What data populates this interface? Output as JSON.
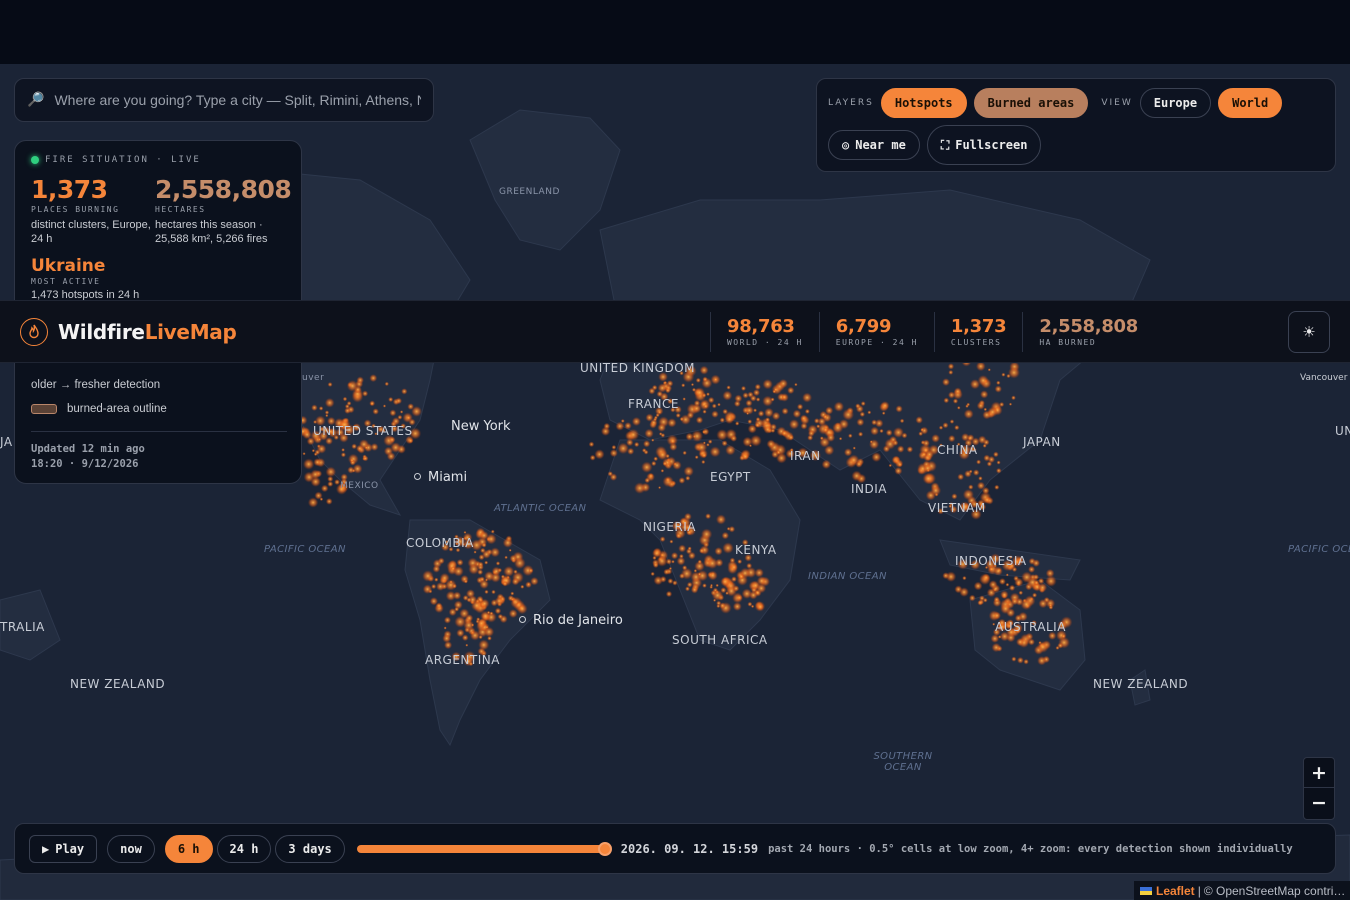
{
  "search": {
    "placeholder": "Where are you going? Type a city — Split, Rimini, Athens, Nice…"
  },
  "layers": {
    "layers_label": "LAYERS",
    "hotspots": "Hotspots",
    "burned_areas": "Burned areas",
    "view_label": "VIEW",
    "europe": "Europe",
    "world": "World",
    "near_me": "Near me",
    "fullscreen": "Fullscreen"
  },
  "situation": {
    "title": "FIRE SITUATION · LIVE",
    "places_value": "1,373",
    "places_label": "PLACES BURNING",
    "places_desc": "distinct clusters, Europe, 24 h",
    "hectares_value": "2,558,808",
    "hectares_label": "HECTARES",
    "hectares_desc": "hectares this season · 25,588 km², 5,266 fires",
    "most_active_value": "Ukraine",
    "most_active_label": "MOST ACTIVE",
    "most_active_desc": "1,473 hotspots in 24 h",
    "legend_fresh": "older → fresher detection",
    "legend_burned": "burned-area outline",
    "updated_line1": "Updated 12 min ago",
    "updated_line2": "18:20 · 9/12/2026"
  },
  "header": {
    "brand_first": "Wildfire",
    "brand_second": "LiveMap",
    "stats": [
      {
        "value": "98,763",
        "label": "WORLD · 24 H"
      },
      {
        "value": "6,799",
        "label": "EUROPE · 24 H"
      },
      {
        "value": "1,373",
        "label": "CLUSTERS"
      },
      {
        "value": "2,558,808",
        "label": "HA BURNED"
      }
    ],
    "theme_icon": "☀"
  },
  "map": {
    "labels": {
      "greenland": "GREENLAND",
      "uk": "UNITED KINGDOM",
      "france": "FRANCE",
      "us": "UNITED STATES",
      "mexico": "MEXICO",
      "iran": "IRAN",
      "china": "CHINA",
      "japan": "JAPAN",
      "egypt": "EGYPT",
      "india": "INDIA",
      "vietnam": "VIETNAM",
      "nigeria": "NIGERIA",
      "kenya": "KENYA",
      "colombia": "COLOMBIA",
      "indonesia": "INDONESIA",
      "australia": "AUSTRALIA",
      "australia_left": "TRALIA",
      "south_africa": "SOUTH AFRICA",
      "argentina": "ARGENTINA",
      "nz_left": "NEW ZEALAND",
      "nz_right": "NEW ZEALAND",
      "ja_left": "JA",
      "un_right": "UN",
      "couver": "uver"
    },
    "oceans": {
      "atlantic": "ATLANTIC OCEAN",
      "pacific_left": "PACIFIC OCEAN",
      "pacific_right": "PACIFIC OCE",
      "indian": "INDIAN OCEAN",
      "southern": "SOUTHERN OCEAN"
    },
    "cities": {
      "new_york": "New York",
      "miami": "Miami",
      "rio": "Rio de Janeiro",
      "vancouver": "Vancouver"
    },
    "colors": {
      "land": "#232d40",
      "ocean": "#1b2436",
      "fire": "#f5853a"
    }
  },
  "zoom": {
    "in": "+",
    "out": "−"
  },
  "timeline": {
    "play": "Play",
    "now": "now",
    "ranges": [
      "6 h",
      "24 h",
      "3 days"
    ],
    "active_range": "6 h",
    "slider_progress": 1.0,
    "date": "2026. 09. 12. 15:59",
    "info": "past 24 hours · 0.5° cells at low zoom, 4+ zoom: every detection shown individually"
  },
  "attribution": {
    "leaflet": "Leaflet",
    "osm": "© OpenStreetMap contri…"
  }
}
